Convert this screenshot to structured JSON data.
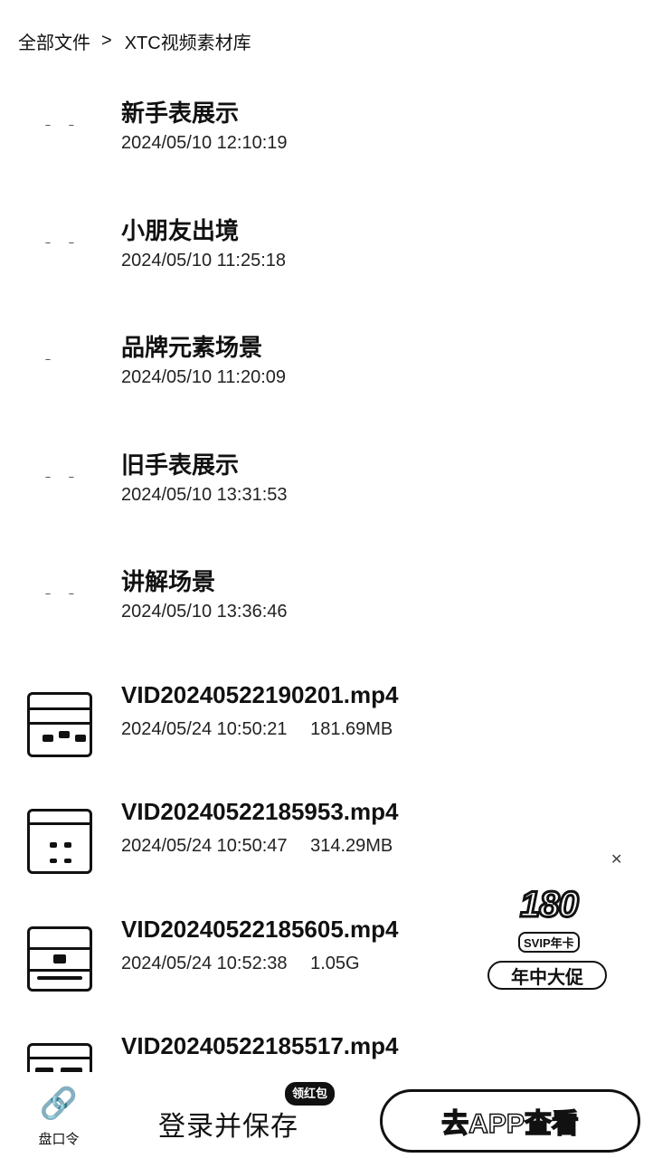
{
  "breadcrumb": {
    "root": "全部文件",
    "separator": ">",
    "current": "XTC视频素材库"
  },
  "files": [
    {
      "name": "新手表展示",
      "date": "2024/05/10 12:10:19",
      "size": "",
      "type": "folder"
    },
    {
      "name": "小朋友出境",
      "date": "2024/05/10 11:25:18",
      "size": "",
      "type": "folder"
    },
    {
      "name": "品牌元素场景",
      "date": "2024/05/10 11:20:09",
      "size": "",
      "type": "folder"
    },
    {
      "name": "旧手表展示",
      "date": "2024/05/10 13:31:53",
      "size": "",
      "type": "folder"
    },
    {
      "name": "讲解场景",
      "date": "2024/05/10 13:36:46",
      "size": "",
      "type": "folder"
    },
    {
      "name": "VID20240522190201.mp4",
      "date": "2024/05/24 10:50:21",
      "size": "181.69MB",
      "type": "video"
    },
    {
      "name": "VID20240522185953.mp4",
      "date": "2024/05/24 10:50:47",
      "size": "314.29MB",
      "type": "video"
    },
    {
      "name": "VID20240522185605.mp4",
      "date": "2024/05/24 10:52:38",
      "size": "1.05G",
      "type": "video"
    },
    {
      "name": "VID20240522185517.mp4",
      "date": "",
      "size": "",
      "type": "video"
    }
  ],
  "promo": {
    "number": "180",
    "tag": "SVIP年卡",
    "label": "年中大促"
  },
  "bottom_bar": {
    "link_label": "盘口令",
    "save_label": "登录并保存",
    "badge": "领红包",
    "open_app_label": "去APP查看"
  },
  "icons": {
    "link": "link-icon",
    "folder": "folder-icon",
    "video": "video-thumbnail"
  }
}
